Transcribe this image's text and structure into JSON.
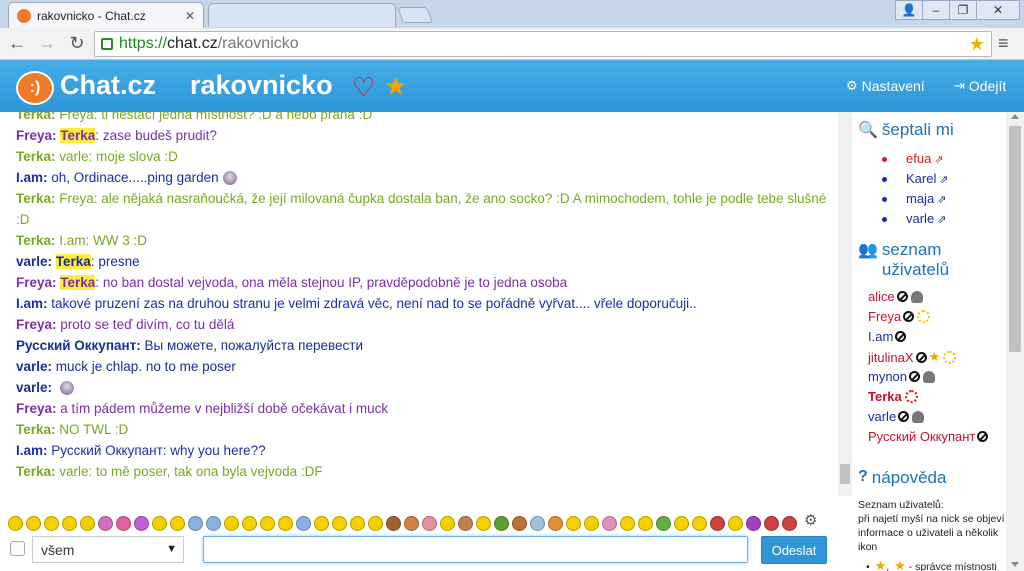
{
  "browser": {
    "tab_title": "rakovnicko - Chat.cz",
    "tab_close": "✕",
    "url_scheme": "https://",
    "url_host": "chat.cz",
    "url_path": "/rakovnicko"
  },
  "header": {
    "brand": "Chat.cz",
    "room": "rakovnicko",
    "settings_label": "Nastavení",
    "logout_label": "Odejít"
  },
  "messages": [
    {
      "nick": "Terka",
      "color": "terka",
      "text": " Freya: ti nestačí jedna místnost? :D a nebo praha :D"
    },
    {
      "nick": "Freya",
      "color": "freya",
      "highlight": "Terka",
      "text": ": zase budeš prudit?"
    },
    {
      "nick": "Terka",
      "color": "terka",
      "text": " varle: moje slova :D"
    },
    {
      "nick": "I.am",
      "color": "iam",
      "text": " oh, Ordinace.....ping garden",
      "smiley": true
    },
    {
      "nick": "Terka",
      "color": "terka",
      "text": " Freya: ale nějaká nasraňoučká, že její milovaná čupka dostala ban, že ano socko? :D A mimochodem, tohle je podle tebe slušné :D"
    },
    {
      "nick": "Terka",
      "color": "terka",
      "text": " I.am: WW 3 :D"
    },
    {
      "nick": "varle",
      "color": "varle",
      "highlight": "Terka",
      "text": ": presne"
    },
    {
      "nick": "Freya",
      "color": "freya",
      "highlight": "Terka",
      "text": ": no ban dostal vejvoda, ona měla stejnou IP, pravděpodobně je to jedna osoba"
    },
    {
      "nick": "I.am",
      "color": "iam",
      "text": " takové pruzení zas na druhou stranu je velmi zdravá věc, není nad to se pořádně vyřvat.... vřele doporučuji.."
    },
    {
      "nick": "Freya",
      "color": "freya",
      "text": " proto se teď divím, co tu dělá"
    },
    {
      "nick": "Русский Оккупант",
      "color": "rus",
      "text": " Вы можете, пожалуйста перевести"
    },
    {
      "nick": "varle",
      "color": "varle",
      "text": " muck je chlap. no to me poser"
    },
    {
      "nick": "varle",
      "color": "varle",
      "text": " ",
      "smiley": true
    },
    {
      "nick": "Freya",
      "color": "freya",
      "text": " a tím pádem můžeme v nejbližší době očekávat i muck"
    },
    {
      "nick": "Terka",
      "color": "terka",
      "text": " NO TWL :D"
    },
    {
      "nick": "I.am",
      "color": "iam",
      "text": " Русский Оккупант: why you here??"
    },
    {
      "nick": "Terka",
      "color": "terka",
      "text": " varle: to mě poser, tak ona byla vejvoda :DF"
    }
  ],
  "sidebar": {
    "whisper_title": "šeptali mi",
    "whispers": [
      {
        "name": "efua",
        "color": "#d42020"
      },
      {
        "name": "Karel",
        "color": "#1a2c9c"
      },
      {
        "name": "maja",
        "color": "#1a2c9c"
      },
      {
        "name": "varle",
        "color": "#1a2c9c"
      }
    ],
    "users_title": "seznam uživatelů",
    "users": [
      {
        "name": "alice",
        "color": "#c8102e",
        "icons": [
          "ban",
          "spy"
        ]
      },
      {
        "name": "Freya",
        "color": "#c8102e",
        "icons": [
          "ban",
          "sun"
        ]
      },
      {
        "name": "I.am",
        "color": "#1a2c9c",
        "icons": [
          "ban"
        ]
      },
      {
        "name": "jitulinaX",
        "color": "#c8102e",
        "icons": [
          "ban",
          "star",
          "sun"
        ]
      },
      {
        "name": "mynon",
        "color": "#1a2c9c",
        "icons": [
          "ban",
          "spy"
        ]
      },
      {
        "name": "Terka",
        "color": "#c8102e",
        "bold": true,
        "icons": [
          "sunred"
        ]
      },
      {
        "name": "varle",
        "color": "#1a2c9c",
        "icons": [
          "ban",
          "spy"
        ]
      },
      {
        "name": "Русский Оккупант",
        "color": "#c8102e",
        "icons": [
          "ban"
        ]
      }
    ],
    "help_title": "nápověda",
    "help_text": "Seznam uživatelů:\npři najetí myší na nick se objeví informace o uživateli a několik ikon",
    "help_bullet": "- správce místnosti"
  },
  "compose": {
    "recipient": "všem",
    "message_value": "",
    "send_label": "Odeslat"
  },
  "emoji_colors": [
    "#f4d000",
    "#f4d000",
    "#f4d000",
    "#f4d000",
    "#f4d000",
    "#d070c0",
    "#e060a0",
    "#c060d0",
    "#f4d000",
    "#f4d000",
    "#8ab0e0",
    "#8ab0e0",
    "#f4d000",
    "#f4d000",
    "#f4d000",
    "#f4d000",
    "#8ab0e0",
    "#f4d000",
    "#f4d000",
    "#f4d000",
    "#f4d000",
    "#a06030",
    "#d08040",
    "#e090a0",
    "#f4d000",
    "#c08050",
    "#f4d000",
    "#5aa030",
    "#c07030",
    "#a0c0e0",
    "#e09030",
    "#f4d000",
    "#f4d000",
    "#e090c0",
    "#f4d000",
    "#f4d000",
    "#60b040",
    "#f4d000",
    "#f4d000",
    "#d04040",
    "#f4d000",
    "#a040c0",
    "#d04040",
    "#d04040"
  ]
}
